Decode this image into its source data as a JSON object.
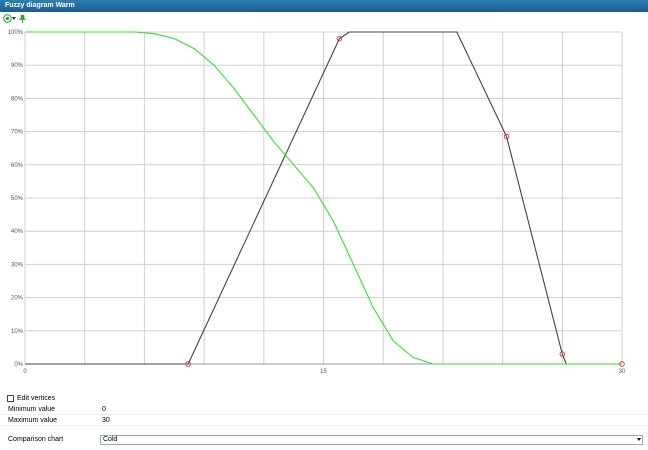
{
  "window": {
    "title": "Fuzzy diagram Warm"
  },
  "toolbar": {
    "settings_icon": "gear-icon",
    "pin_icon": "pin-icon"
  },
  "chart_data": {
    "type": "line",
    "x_ticks": [
      0,
      15,
      30
    ],
    "y_ticks": [
      "0%",
      "10%",
      "20%",
      "30%",
      "40%",
      "50%",
      "60%",
      "70%",
      "80%",
      "90%",
      "100%"
    ],
    "xlim": [
      0,
      30
    ],
    "ylim": [
      0,
      100
    ],
    "grid": true,
    "series": [
      {
        "color": "#444444",
        "points": [
          [
            0,
            0
          ],
          [
            8.2,
            0
          ],
          [
            15.8,
            98
          ],
          [
            16.3,
            100
          ],
          [
            21.7,
            100
          ],
          [
            24.2,
            68.5
          ],
          [
            27,
            3
          ],
          [
            27.2,
            0
          ],
          [
            30,
            0
          ]
        ],
        "vertices": [
          [
            8.2,
            0
          ],
          [
            15.8,
            98
          ],
          [
            24.2,
            68.5
          ],
          [
            27,
            3
          ]
        ]
      },
      {
        "color": "#33dd33",
        "points": [
          [
            0,
            100
          ],
          [
            5.5,
            100
          ],
          [
            6.5,
            99.5
          ],
          [
            7.5,
            98
          ],
          [
            8.5,
            95
          ],
          [
            9.5,
            90
          ],
          [
            10.5,
            83
          ],
          [
            11.5,
            75
          ],
          [
            12.5,
            67
          ],
          [
            13.5,
            60
          ],
          [
            14.5,
            53
          ],
          [
            15.5,
            43
          ],
          [
            16.5,
            30
          ],
          [
            17.5,
            17
          ],
          [
            18.5,
            7
          ],
          [
            19.5,
            2
          ],
          [
            20.5,
            0
          ],
          [
            30,
            0
          ]
        ],
        "vertices": [
          [
            30,
            0
          ]
        ]
      }
    ]
  },
  "props": {
    "edit_vertices_label": "Edit vertices",
    "min_label": "Minimum value",
    "min_value": "0",
    "max_label": "Maximum value",
    "max_value": "30",
    "comparison_label": "Comparison chart",
    "comparison_value": "Cold"
  }
}
